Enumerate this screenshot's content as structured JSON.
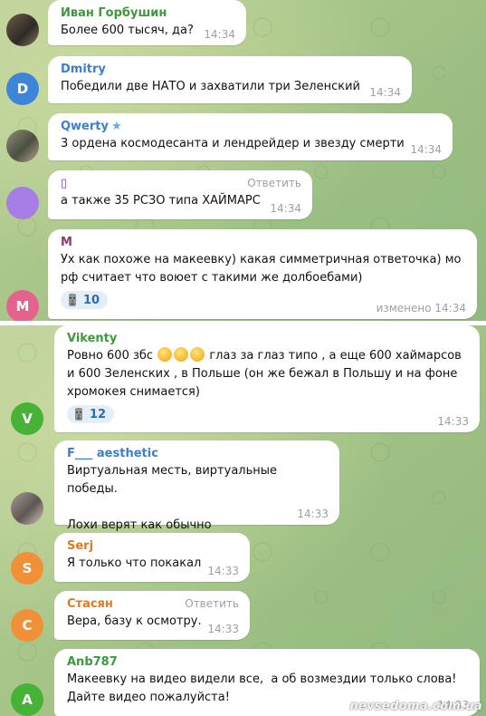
{
  "colors": {
    "name_ivan": "#3c9a3c",
    "name_dmitry": "#3a7fd0",
    "name_qwerty": "#3a7fd0",
    "name_box": "#7b3fc9",
    "name_m": "#8b3a6f",
    "name_vikenty": "#3c9a3c",
    "name_f": "#3a7fd0",
    "name_serj": "#e07a1c",
    "name_stasyan": "#e07a1c",
    "name_anb": "#3c9a3c",
    "avatar_dmitry": "#3d85d8",
    "avatar_box": "#a77ee8",
    "avatar_m": "#e5628c",
    "avatar_v": "#47b336",
    "avatar_s": "#f0913a",
    "avatar_c": "#f0913a",
    "avatar_a": "#47b336"
  },
  "messages": [
    {
      "author": "Иван Горбушин",
      "avatar": "photo",
      "text": "Более 600 тысяч, да?",
      "time": "14:34"
    },
    {
      "author": "Dmitry",
      "avatar_letter": "D",
      "text": "Победили две НАТО и захватили три Зеленский",
      "time": "14:34"
    },
    {
      "author": "Qwerty",
      "badge": "star-icon",
      "avatar": "photo",
      "text": "3 ордена космодесанта и лендрейдер и звезду смерти",
      "time": "14:34"
    },
    {
      "author": "▯",
      "avatar": "purple-circle",
      "reply_label": "Ответить",
      "text": "а также 35 РСЗО типа ХАЙМАРС",
      "time": "14:34"
    },
    {
      "author": "M",
      "avatar_letter": "M",
      "text": "Ух как похоже на макеевку) какая симметричная ответочка) мо\nрф считает что воюет с такими же долбоебами)",
      "reaction": {
        "icon": "moai-icon",
        "count": "10"
      },
      "time": "изменено 14:34"
    },
    {
      "author": "Vikenty",
      "avatar_letter": "V",
      "text_before": "Ровно 600 збс",
      "emoji": [
        "rofl-emoji",
        "rofl-emoji",
        "rofl-emoji"
      ],
      "text_after": " глаз за глаз типо , а еще 600 хаймарсов\nи 600 Зеленских , в Польше (он же бежал в Польшу и на фоне\nхромокея снимается)",
      "reaction": {
        "icon": "moai-icon",
        "count": "12"
      },
      "time": "14:33"
    },
    {
      "author": "F___ aesthetic",
      "avatar": "photo",
      "text": "Виртуальная месть, виртуальные победы.\n\nЛохи верят как обычно",
      "time": "14:33"
    },
    {
      "author": "Serj",
      "avatar_letter": "S",
      "text": "Я только что покакал",
      "time": "14:33"
    },
    {
      "author": "Стасян",
      "avatar_letter": "C",
      "reply_label": "Ответить",
      "text": "Вера, базу к осмотру.",
      "time": "14:33"
    },
    {
      "author": "Anb787",
      "avatar_letter": "A",
      "text": "Макеевку на видео видели все,  а об возмездии только слова!\nДайте видео пожалуйста!",
      "time": "14:33"
    }
  ],
  "watermark": "nevsedoma.com.ua"
}
